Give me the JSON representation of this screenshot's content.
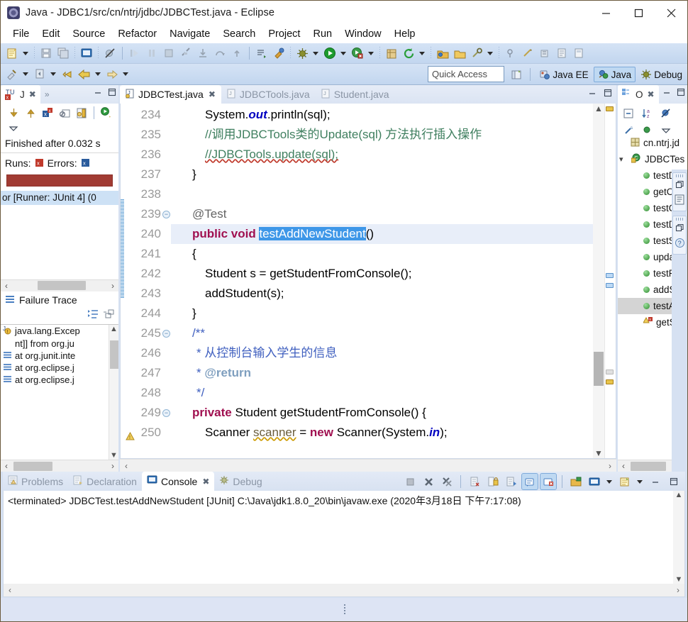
{
  "window": {
    "title": "Java - JDBC1/src/cn/ntrj/jdbc/JDBCTest.java - Eclipse",
    "minimize_label": "—",
    "maximize_label": "☐",
    "close_label": "✕"
  },
  "menubar": {
    "items": [
      {
        "label": "File"
      },
      {
        "label": "Edit"
      },
      {
        "label": "Source"
      },
      {
        "label": "Refactor"
      },
      {
        "label": "Navigate"
      },
      {
        "label": "Search"
      },
      {
        "label": "Project"
      },
      {
        "label": "Run"
      },
      {
        "label": "Window"
      },
      {
        "label": "Help"
      }
    ]
  },
  "toolbar": {
    "quick_access_placeholder": "Quick Access",
    "perspectives": [
      {
        "label": "Java EE",
        "active": false
      },
      {
        "label": "Java",
        "active": true
      },
      {
        "label": "Debug",
        "active": false
      }
    ]
  },
  "junit_view": {
    "tab_label": "J",
    "tab_overflow": "»",
    "status": "Finished after 0.032 s",
    "runs_label": "Runs:",
    "errors_label": "Errors:",
    "bar_color": "#a13b33",
    "tree_row": "or [Runner: JUnit 4] (0",
    "failure_trace_label": "Failure Trace",
    "trace": [
      {
        "text": "java.lang.Excep",
        "type": "exception"
      },
      {
        "text": "nt]] from org.ju",
        "type": "continuation"
      },
      {
        "text": "at org.junit.intе",
        "type": "stack"
      },
      {
        "text": "at org.eclipse.j",
        "type": "stack"
      },
      {
        "text": "at org.eclipse.j",
        "type": "stack"
      }
    ]
  },
  "editor": {
    "tabs": [
      {
        "label": "JDBCTest.java",
        "active": true,
        "closeable": true
      },
      {
        "label": "JDBCTools.java",
        "active": false,
        "closeable": false
      },
      {
        "label": "Student.java",
        "active": false,
        "closeable": false
      }
    ],
    "first_line_number": 234,
    "lines": [
      {
        "n": 234,
        "fold": false,
        "highlight": false
      },
      {
        "n": 235,
        "fold": false,
        "highlight": false
      },
      {
        "n": 236,
        "fold": false,
        "highlight": false
      },
      {
        "n": 237,
        "fold": false,
        "highlight": false
      },
      {
        "n": 238,
        "fold": false,
        "highlight": false
      },
      {
        "n": 239,
        "fold": true,
        "highlight": false
      },
      {
        "n": 240,
        "fold": false,
        "highlight": true
      },
      {
        "n": 241,
        "fold": false,
        "highlight": false
      },
      {
        "n": 242,
        "fold": false,
        "highlight": false
      },
      {
        "n": 243,
        "fold": false,
        "highlight": false
      },
      {
        "n": 244,
        "fold": false,
        "highlight": false
      },
      {
        "n": 245,
        "fold": true,
        "highlight": false
      },
      {
        "n": 246,
        "fold": false,
        "highlight": false
      },
      {
        "n": 247,
        "fold": false,
        "highlight": false
      },
      {
        "n": 248,
        "fold": false,
        "highlight": false
      },
      {
        "n": 249,
        "fold": true,
        "highlight": false
      },
      {
        "n": 250,
        "fold": false,
        "highlight": false,
        "warning": true
      }
    ],
    "code_text": {
      "l234_a": "System.",
      "l234_b": "out",
      "l234_c": ".println(sql);",
      "l235": "//调用JDBCTools类的Update(sql) 方法执行插入操作",
      "l236": "//JDBCTools.update(sql);",
      "l237": "}",
      "l238": "",
      "l239": "@Test",
      "l240_a": "public void ",
      "l240_b": "testAddNewStudent",
      "l240_c": "()",
      "l241": "{",
      "l242": "Student s = getStudentFromConsole();",
      "l243": "addStudent(s);",
      "l244": "}",
      "l245": "/**",
      "l246": "* 从控制台输入学生的信息",
      "l247_a": "* ",
      "l247_b": "@return",
      "l248": "*/",
      "l249_a": "private ",
      "l249_b": "Student getStudentFromConsole() {",
      "l250_a": "Scanner ",
      "l250_b": "scanner",
      "l250_c": " = ",
      "l250_d": "new",
      "l250_e": " Scanner(System.",
      "l250_f": "in",
      "l250_g": ");"
    },
    "selection_color": "#3e97e8",
    "highlight_color": "#e8eef9"
  },
  "outline_view": {
    "tab_label": "O",
    "items": [
      {
        "label": "cn.ntrj.jd",
        "icon": "package-icon",
        "indent": 1,
        "selected": false
      },
      {
        "label": "JDBCTes",
        "icon": "class-icon",
        "indent": 0,
        "selected": false,
        "expanded": true
      },
      {
        "label": "testD",
        "icon": "method-icon",
        "indent": 2,
        "selected": false
      },
      {
        "label": "getC",
        "icon": "method-icon",
        "indent": 2,
        "selected": false
      },
      {
        "label": "testC",
        "icon": "method-icon",
        "indent": 2,
        "selected": false
      },
      {
        "label": "testD",
        "icon": "method-icon",
        "indent": 2,
        "selected": false
      },
      {
        "label": "testS",
        "icon": "method-icon",
        "indent": 2,
        "selected": false
      },
      {
        "label": "upda",
        "icon": "method-icon",
        "indent": 2,
        "selected": false
      },
      {
        "label": "testR",
        "icon": "method-icon",
        "indent": 2,
        "selected": false
      },
      {
        "label": "addS",
        "icon": "method-icon",
        "indent": 2,
        "selected": false
      },
      {
        "label": "testA",
        "icon": "method-icon",
        "indent": 2,
        "selected": true
      },
      {
        "label": "getS",
        "icon": "method-warning-icon",
        "indent": 2,
        "selected": false
      }
    ]
  },
  "bottom_panel": {
    "tabs": [
      {
        "label": "Problems",
        "active": false,
        "icon": "problems-icon"
      },
      {
        "label": "Declaration",
        "active": false,
        "icon": "declaration-icon"
      },
      {
        "label": "Console",
        "active": true,
        "icon": "console-icon"
      },
      {
        "label": "Debug",
        "active": false,
        "icon": "debug-icon"
      }
    ],
    "console_status": "<terminated> JDBCTest.testAddNewStudent [JUnit] C:\\Java\\jdk1.8.0_20\\bin\\javaw.exe (2020年3月18日 下午7:17:08)",
    "console_output": ""
  },
  "colors": {
    "chrome": "#d6e1f2",
    "toolbar_top": "#d5e3f5",
    "toolbar_bottom": "#c2d6ef",
    "accent_blue": "#3e97e8",
    "error_red": "#a13b33",
    "keyword": "#a01050",
    "comment": "#3f7f5f",
    "javadoc": "#3f5fbf",
    "static_field": "#0000c0"
  }
}
